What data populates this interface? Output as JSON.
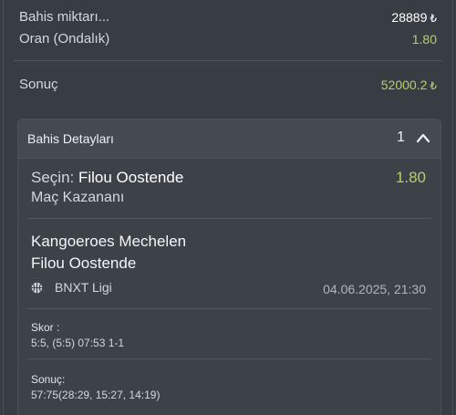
{
  "summary": {
    "stake_label": "Bahis miktarı...",
    "stake_value": "28889",
    "odds_label": "Oran (Ondalık)",
    "odds_value": "1.80",
    "result_label": "Sonuç",
    "result_value": "52000.2",
    "currency_symbol": "₺"
  },
  "details": {
    "title": "Bahis Detayları",
    "count": "1",
    "selection_prefix": "Seçin:",
    "selection_name": "Filou Oostende",
    "selection_odds": "1.80",
    "market": "Maç Kazananı",
    "home_team": "Kangoeroes Mechelen",
    "away_team": "Filou Oostende",
    "league_icon": "basketball-icon",
    "league_name": "BNXT Ligi",
    "match_datetime": "04.06.2025, 21:30",
    "score_label": "Skor :",
    "score_value": "5:5, (5:5) 07:53 1-1",
    "result_label": "Sonuç:",
    "result_value": "57:75(28:29, 15:27, 14:19)"
  },
  "colors": {
    "background": "#383d44",
    "card_header": "#454a52",
    "accent_green": "#b6cf6a",
    "text_primary": "#ffffff",
    "text_secondary": "#d3d8de"
  }
}
